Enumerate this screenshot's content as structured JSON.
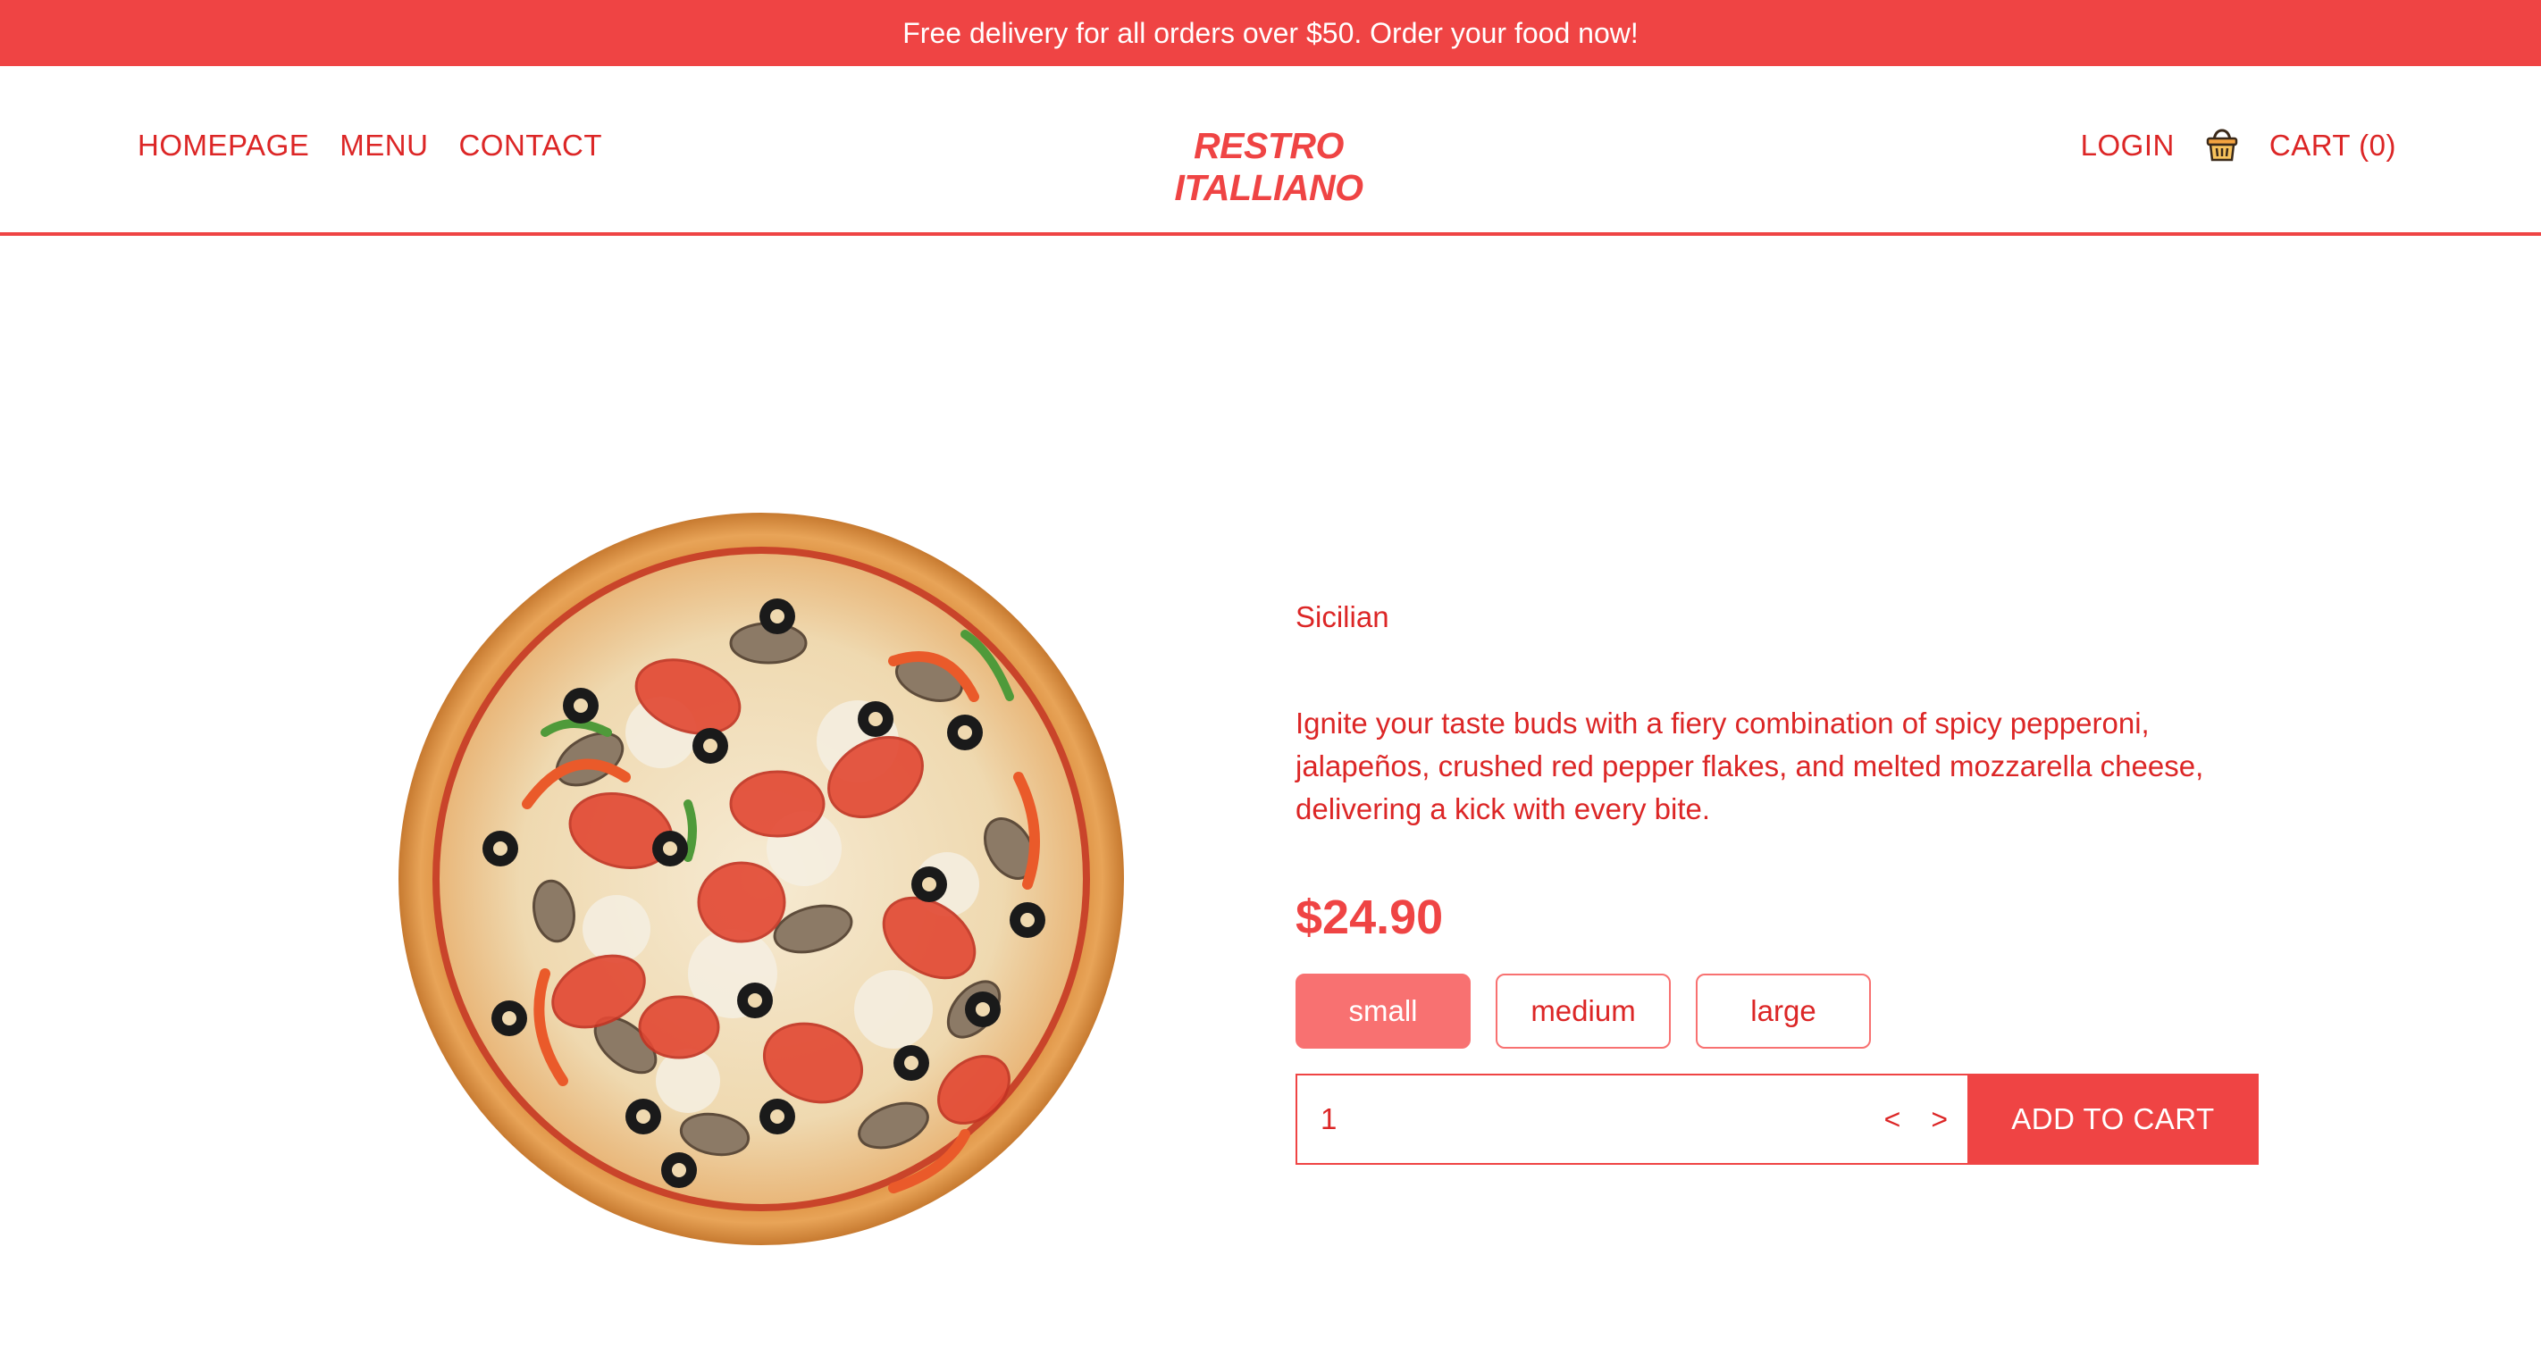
{
  "promo": {
    "text": "Free delivery for all orders over $50. Order your food now!"
  },
  "header": {
    "nav_left": [
      "HOMEPAGE",
      "MENU",
      "CONTACT"
    ],
    "brand": "RESTRO ITALLIANO",
    "login_label": "LOGIN",
    "cart_label": "CART (0)",
    "cart_icon": "basket-icon"
  },
  "product": {
    "image": "pizza-image",
    "name": "Sicilian",
    "description": "Ignite your taste buds with a fiery combination of spicy pepperoni, jalapeños, crushed red pepper flakes, and melted mozzarella cheese, delivering a kick with every bite.",
    "price": "$24.90",
    "sizes": [
      "small",
      "medium",
      "large"
    ],
    "selected_size": "small",
    "quantity": "1",
    "qty_decrement": "<",
    "qty_increment": ">",
    "add_to_cart_label": "ADD TO CART"
  },
  "colors": {
    "accent": "#ef4444",
    "text": "#dc2626",
    "size_active": "#f87171"
  }
}
